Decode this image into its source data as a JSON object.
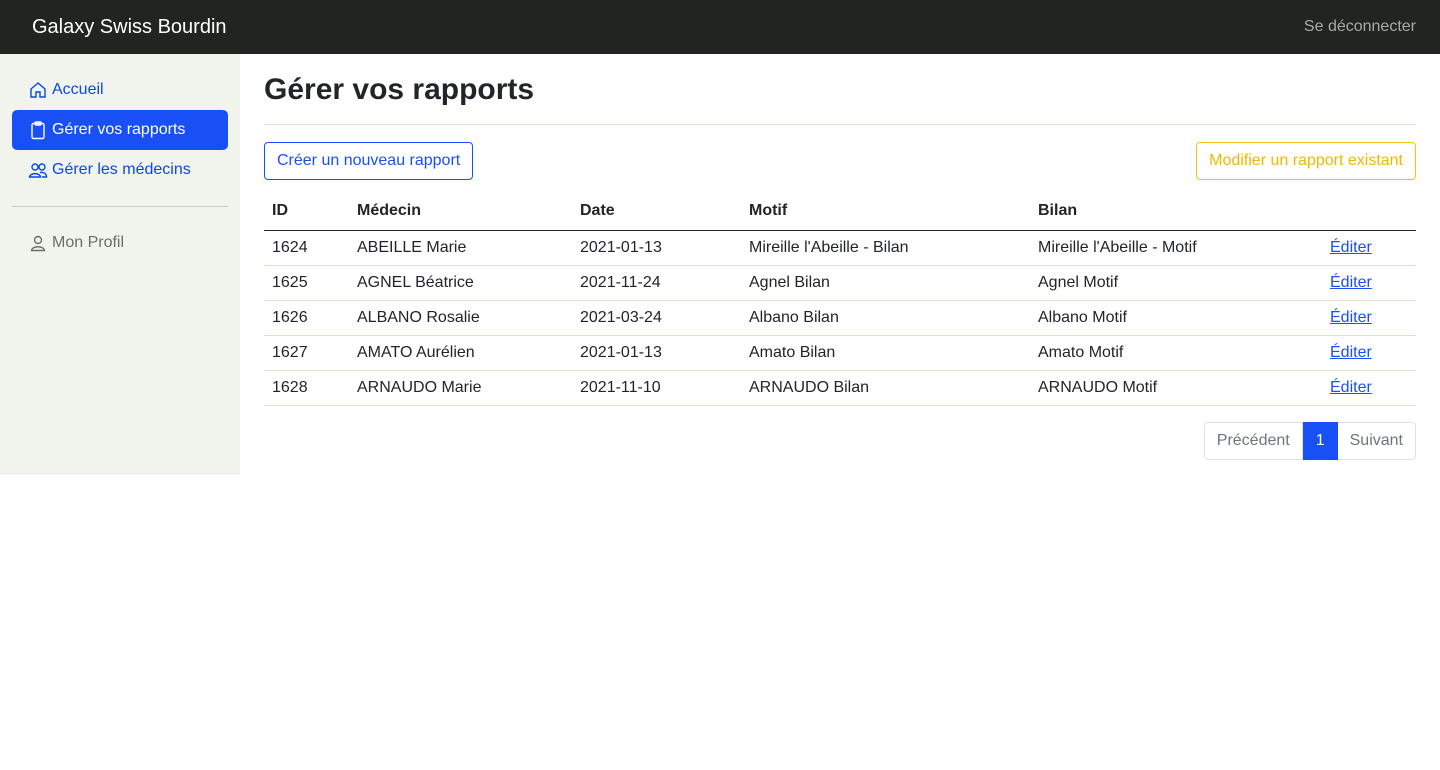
{
  "navbar": {
    "brand": "Galaxy Swiss Bourdin",
    "logout": "Se déconnecter"
  },
  "sidebar": {
    "items": [
      {
        "label": "Accueil",
        "icon": "home-icon"
      },
      {
        "label": "Gérer vos rapports",
        "icon": "clipboard-icon"
      },
      {
        "label": "Gérer les médecins",
        "icon": "people-icon"
      }
    ],
    "profile": {
      "label": "Mon Profil",
      "icon": "person-icon"
    }
  },
  "main": {
    "title": "Gérer vos rapports",
    "create_button": "Créer un nouveau rapport",
    "modify_button": "Modifier un rapport existant",
    "table": {
      "headers": [
        "ID",
        "Médecin",
        "Date",
        "Motif",
        "Bilan",
        ""
      ],
      "rows": [
        [
          "1624",
          "ABEILLE Marie",
          "2021-01-13",
          "Mireille l'Abeille - Bilan",
          "Mireille l'Abeille - Motif",
          "Éditer"
        ],
        [
          "1625",
          "AGNEL Béatrice",
          "2021-11-24",
          "Agnel Bilan",
          "Agnel Motif",
          "Éditer"
        ],
        [
          "1626",
          "ALBANO Rosalie",
          "2021-03-24",
          "Albano Bilan",
          "Albano Motif",
          "Éditer"
        ],
        [
          "1627",
          "AMATO Aurélien",
          "2021-01-13",
          "Amato Bilan",
          "Amato Motif",
          "Éditer"
        ],
        [
          "1628",
          "ARNAUDO Marie",
          "2021-11-10",
          "ARNAUDO Bilan",
          "ARNAUDO Motif",
          "Éditer"
        ]
      ]
    },
    "pagination": {
      "previous": "Précédent",
      "current": "1",
      "next": "Suivant"
    }
  },
  "colors": {
    "primary": "#1850f6",
    "warning": "#f0b800",
    "navbar": "#212421",
    "sidebar": "#f1f4ec"
  }
}
